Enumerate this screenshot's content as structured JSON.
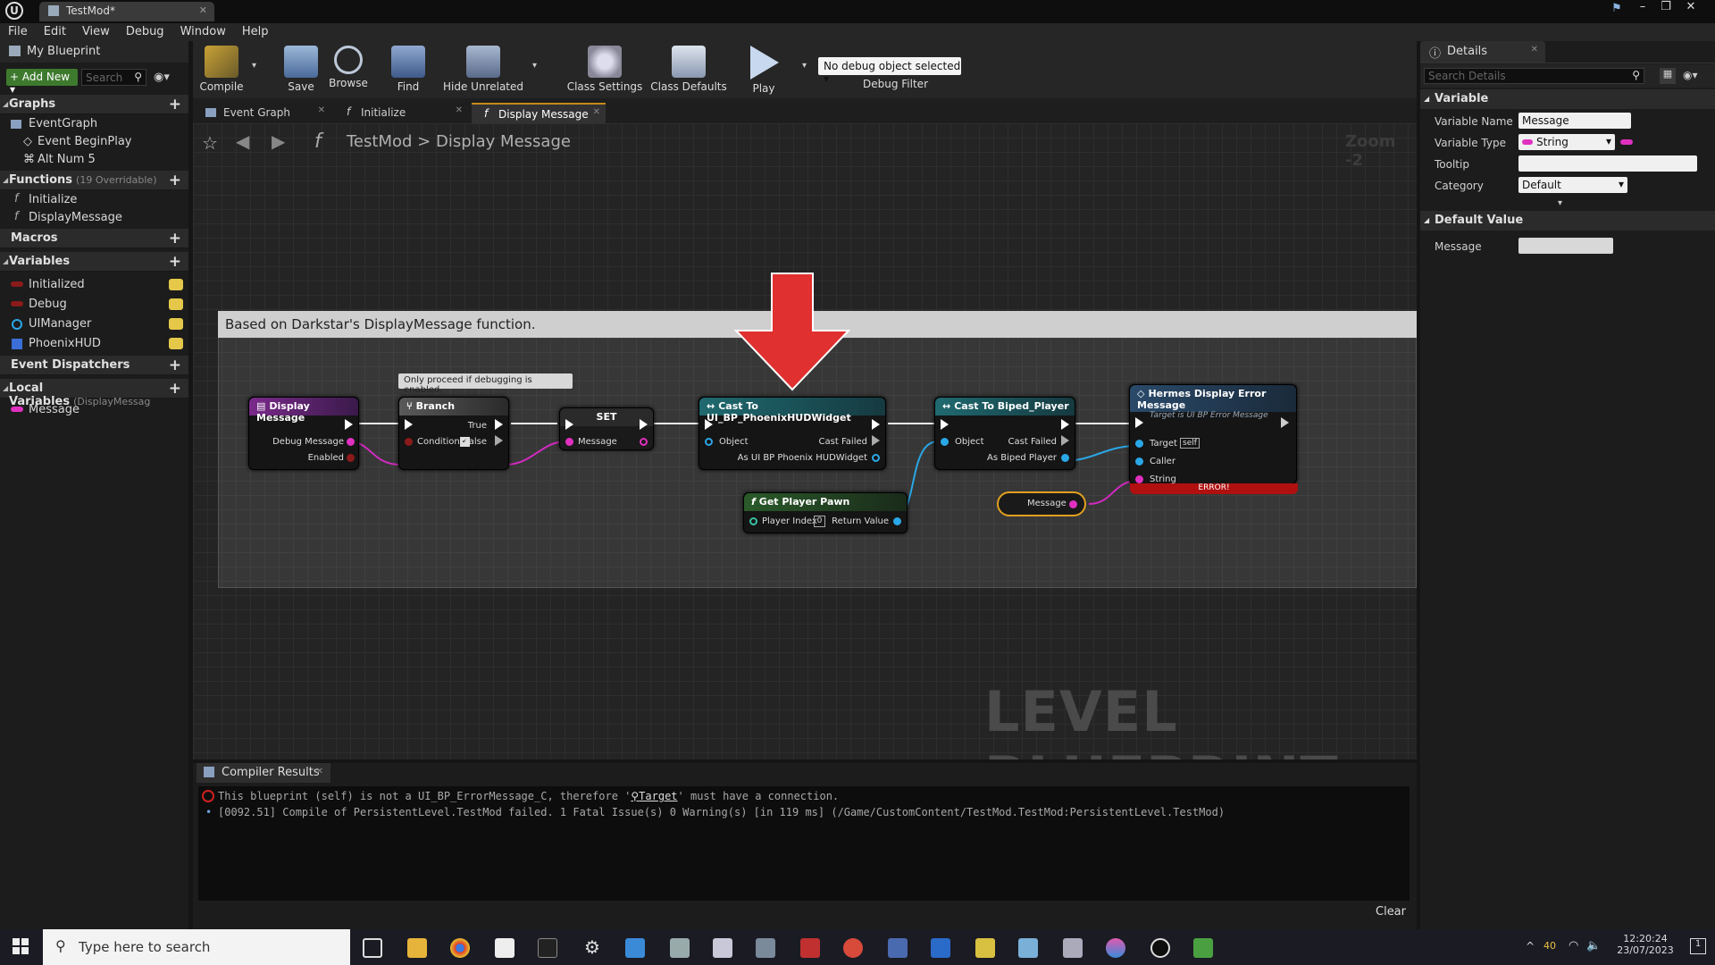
{
  "window": {
    "tab_title": "TestMod*",
    "minimize": "–",
    "maximize": "❐",
    "close": "✕"
  },
  "menu": [
    "File",
    "Edit",
    "View",
    "Debug",
    "Window",
    "Help"
  ],
  "my_blueprint": {
    "title": "My Blueprint",
    "add_new": "Add New",
    "search_placeholder": "Search",
    "sections": {
      "graphs": "Graphs",
      "functions": "Functions",
      "functions_sub": "(19 Overridable)",
      "macros": "Macros",
      "variables": "Variables",
      "event_dispatchers": "Event Dispatchers",
      "local_variables": "Local Variables",
      "local_variables_sub": "(DisplayMessag"
    },
    "graphs": [
      "EventGraph",
      "Event BeginPlay",
      "Alt Num 5"
    ],
    "functions": [
      "Initialize",
      "DisplayMessage"
    ],
    "variables": [
      {
        "name": "Initialized",
        "color": "#8b1a1a"
      },
      {
        "name": "Debug",
        "color": "#8b1a1a"
      },
      {
        "name": "UIManager",
        "color": "#2aa7e6"
      },
      {
        "name": "PhoenixHUD",
        "color": "#3a6fd8"
      }
    ],
    "local_variables": [
      {
        "name": "Message",
        "color": "#e030c0"
      }
    ]
  },
  "toolbar": {
    "compile": "Compile",
    "save": "Save",
    "browse": "Browse",
    "find": "Find",
    "hide_unrelated": "Hide Unrelated",
    "class_settings": "Class Settings",
    "class_defaults": "Class Defaults",
    "play": "Play",
    "debug_object": "No debug object selected",
    "debug_filter": "Debug Filter"
  },
  "graph_tabs": [
    "Event Graph",
    "Initialize",
    "Display Message"
  ],
  "breadcrumb": {
    "root": "TestMod",
    "separator": ">",
    "current": "Display Message"
  },
  "zoom": "Zoom -2",
  "watermark": "LEVEL BLUEPRINT",
  "comment": "Based on Darkstar's DisplayMessage function.",
  "nodes": {
    "display_message": {
      "title": "Display Message",
      "pin_debug": "Debug Message",
      "pin_enabled": "Enabled"
    },
    "branch": {
      "title": "Branch",
      "pin_condition": "Condition",
      "pin_true": "True",
      "pin_false": "False",
      "comment": "Only proceed if debugging is enabled."
    },
    "set": {
      "title": "SET",
      "pin_message": "Message"
    },
    "cast_phoenix": {
      "title": "Cast To UI_BP_PhoenixHUDWidget",
      "pin_object": "Object",
      "pin_failed": "Cast Failed",
      "pin_as": "As UI BP Phoenix HUDWidget"
    },
    "get_pawn": {
      "title": "Get Player Pawn",
      "pin_index": "Player Index",
      "index_value": "0",
      "pin_return": "Return Value"
    },
    "cast_biped": {
      "title": "Cast To Biped_Player",
      "pin_object": "Object",
      "pin_failed": "Cast Failed",
      "pin_as": "As Biped Player"
    },
    "hermes": {
      "title": "Hermes Display Error Message",
      "subtitle": "Target is UI BP Error Message",
      "pin_target": "Target",
      "target_value": "self",
      "pin_caller": "Caller",
      "pin_string": "String",
      "error": "ERROR!"
    },
    "message_var": {
      "title": "Message"
    }
  },
  "details": {
    "title": "Details",
    "search_placeholder": "Search Details",
    "variable_section": "Variable",
    "variable_name_label": "Variable Name",
    "variable_name": "Message",
    "variable_type_label": "Variable Type",
    "variable_type": "String",
    "tooltip_label": "Tooltip",
    "tooltip": "",
    "category_label": "Category",
    "category": "Default",
    "default_value_section": "Default Value",
    "default_message_label": "Message",
    "default_message": ""
  },
  "compiler": {
    "tab": "Compiler Results",
    "line1_pre": "This blueprint (self) is not a UI_BP_ErrorMessage_C, therefore '",
    "line1_link": "Target",
    "line1_post": "' must have a connection.",
    "line2": "[0092.51] Compile of PersistentLevel.TestMod failed. 1 Fatal Issue(s) 0 Warning(s) [in 119 ms] (/Game/CustomContent/TestMod.TestMod:PersistentLevel.TestMod)",
    "clear": "Clear"
  },
  "taskbar": {
    "search": "Type here to search",
    "time": "12:20:24",
    "date": "23/07/2023",
    "temp": "40"
  }
}
